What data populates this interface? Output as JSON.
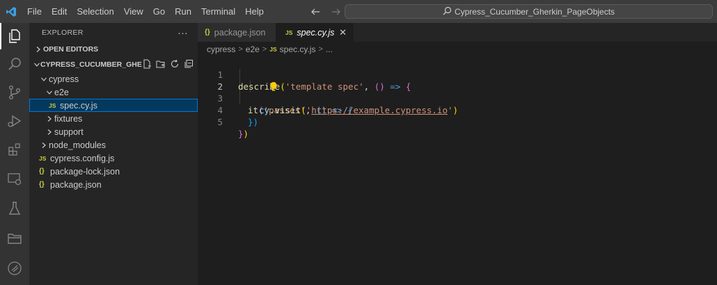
{
  "window": {
    "title": "Cypress_Cucumber_Gherkin_PageObjects"
  },
  "menu": [
    "File",
    "Edit",
    "Selection",
    "View",
    "Go",
    "Run",
    "Terminal",
    "Help"
  ],
  "colors": {
    "accent": "#0078d4",
    "titlebar": "#3c3c3c",
    "sidebar": "#252526",
    "editor": "#1e1e1e"
  },
  "activity_bar": [
    "explorer-icon",
    "search-icon",
    "source-control-icon",
    "run-debug-icon",
    "extensions-icon",
    "remote-explorer-icon",
    "testing-icon",
    "folder-icon",
    "cypress-icon"
  ],
  "explorer": {
    "title": "EXPLORER",
    "more": "···",
    "open_editors": "OPEN EDITORS",
    "project": "CYPRESS_CUCUMBER_GHER...",
    "tree": [
      {
        "label": "cypress",
        "indent": 1,
        "chevron": "open"
      },
      {
        "label": "e2e",
        "indent": 2,
        "chevron": "open"
      },
      {
        "label": "spec.cy.js",
        "indent": 3,
        "icon": "JS",
        "selected": true
      },
      {
        "label": "fixtures",
        "indent": 2,
        "chevron": "closed"
      },
      {
        "label": "support",
        "indent": 2,
        "chevron": "closed"
      },
      {
        "label": "node_modules",
        "indent": 1,
        "chevron": "closed"
      },
      {
        "label": "cypress.config.js",
        "indent": 1,
        "icon": "JS"
      },
      {
        "label": "package-lock.json",
        "indent": 1,
        "icon": "{}"
      },
      {
        "label": "package.json",
        "indent": 1,
        "icon": "{}"
      }
    ]
  },
  "tabs": [
    {
      "icon": "{}",
      "label": "package.json",
      "active": false
    },
    {
      "icon": "JS",
      "label": "spec.cy.js",
      "active": true,
      "close": "✕"
    }
  ],
  "breadcrumb": {
    "folder1": "cypress",
    "folder2": "e2e",
    "icon": "JS",
    "file": "spec.cy.js",
    "tail": "..."
  },
  "editor": {
    "line_numbers": [
      "1",
      "2",
      "3",
      "4",
      "5"
    ],
    "line1": {
      "fn": "describe",
      "str": "'template spec'",
      "sep": ", ",
      "arrow": "=>"
    },
    "line2": {
      "fn": "it",
      "str": "'passes'",
      "sep": ", ",
      "arrow": "=>"
    },
    "line3": {
      "obj": "cy",
      "dot": ".",
      "fn": "visit",
      "q1": "'",
      "url": "https://example.cypress.io",
      "q2": "'"
    }
  }
}
